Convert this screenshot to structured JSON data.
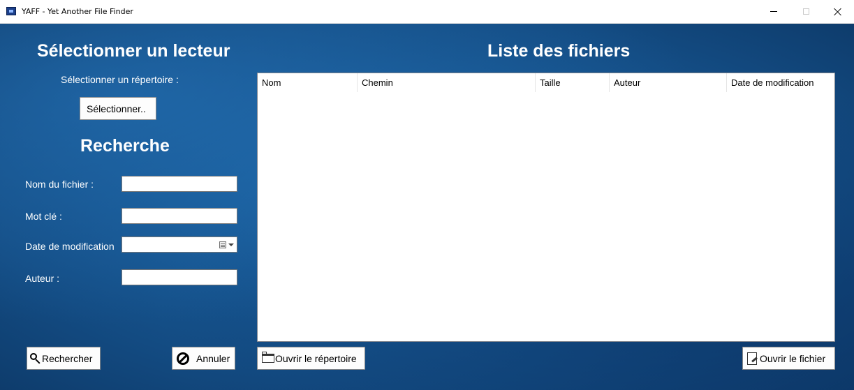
{
  "window": {
    "title": "YAFF - Yet Another File Finder",
    "icon": "app-folder-icon"
  },
  "drive": {
    "heading": "Sélectionner un lecteur",
    "dir_label": "Sélectionner un répertoire :",
    "select_button": "Sélectionner.."
  },
  "search": {
    "heading": "Recherche",
    "filename_label": "Nom du fichier :",
    "filename_value": "",
    "keyword_label": "Mot clé :",
    "keyword_value": "",
    "date_label": "Date de modification",
    "date_value": "",
    "author_label": "Auteur :",
    "author_value": "",
    "search_button": "Rechercher",
    "cancel_button": "Annuler"
  },
  "files": {
    "heading": "Liste des fichiers",
    "columns": [
      "Nom",
      "Chemin",
      "Taille",
      "Auteur",
      "Date de modification"
    ],
    "rows": [],
    "open_dir_button": "Ouvrir le répertoire",
    "open_file_button": "Ouvrir le fichier"
  },
  "colors": {
    "background": "#1c66a8",
    "accent_text": "#ffffff"
  }
}
